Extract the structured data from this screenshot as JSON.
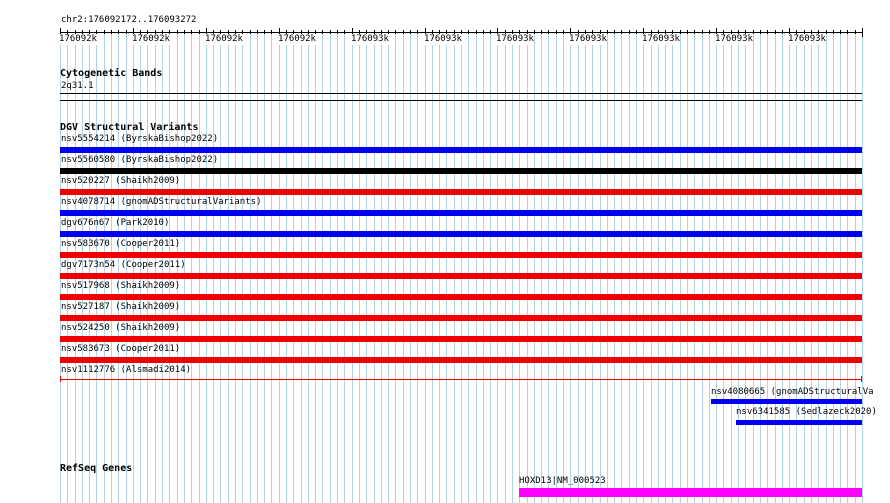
{
  "ruler": {
    "range_label": "chr2:176092172..176093272",
    "tick_labels": [
      "176092k",
      "176092k",
      "176092k",
      "176092k",
      "176093k",
      "176093k",
      "176093k",
      "176093k",
      "176093k",
      "176093k",
      "176093k"
    ]
  },
  "cyto": {
    "title": "Cytogenetic Bands",
    "band": "2q31.1"
  },
  "dgv": {
    "title": "DGV Structural Variants",
    "features": [
      {
        "label": "nsv5554214 (ByrskaBishop2022)",
        "color": "#0000ee"
      },
      {
        "label": "nsv5560580 (ByrskaBishop2022)",
        "color": "#000000"
      },
      {
        "label": "nsv520227 (Shaikh2009)",
        "color": "#ee0000"
      },
      {
        "label": "nsv4078714 (gnomADStructuralVariants)",
        "color": "#0000ee"
      },
      {
        "label": "dgv676n67 (Park2010)",
        "color": "#0000ee"
      },
      {
        "label": "nsv583670 (Cooper2011)",
        "color": "#ee0000"
      },
      {
        "label": "dgv7173n54 (Cooper2011)",
        "color": "#ee0000"
      },
      {
        "label": "nsv517968 (Shaikh2009)",
        "color": "#ee0000"
      },
      {
        "label": "nsv527187 (Shaikh2009)",
        "color": "#ee0000"
      },
      {
        "label": "nsv524250 (Shaikh2009)",
        "color": "#ee0000"
      },
      {
        "label": "nsv583673 (Cooper2011)",
        "color": "#ee0000"
      },
      {
        "label": "nsv1112776 (Alsmadi2014)",
        "color": "#ee0000"
      }
    ],
    "extra": [
      {
        "label": "nsv4080665 (gnomADStructuralVa",
        "color": "#0000ee"
      },
      {
        "label": "nsv6341585 (Sedlazeck2020)",
        "color": "#0000ee"
      }
    ]
  },
  "refseq": {
    "title": "RefSeq Genes",
    "gene_label": "HOXD13|NM_000523",
    "color": "#ff00ff"
  }
}
